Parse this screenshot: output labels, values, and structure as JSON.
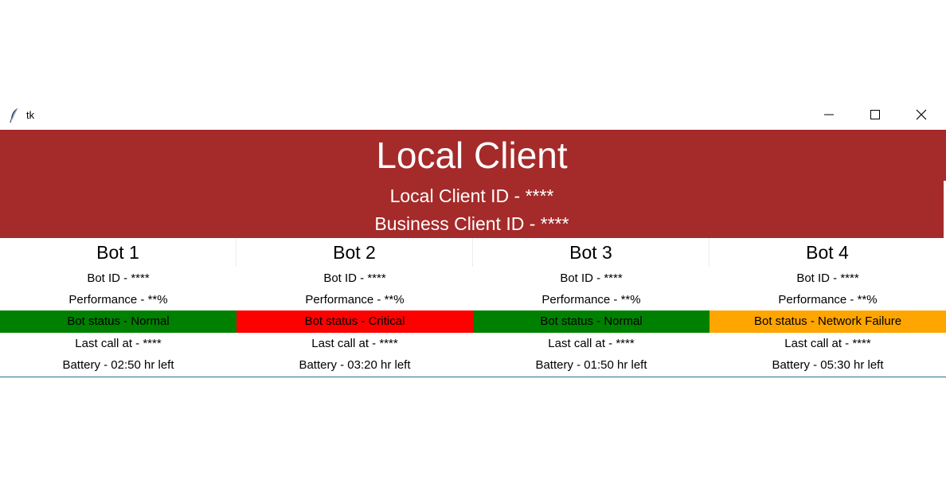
{
  "window": {
    "title": "tk"
  },
  "header": {
    "title": "Local Client",
    "local_client_id": "Local Client ID - ****",
    "business_client_id": "Business Client ID - ****",
    "background": "#a52a2a"
  },
  "bots": [
    {
      "name": "Bot 1",
      "bot_id": "Bot ID - ****",
      "performance": "Performance - **%",
      "status": "Bot status - Normal",
      "status_color": "#008000",
      "last_call": "Last call at - ****",
      "battery": "Battery - 02:50 hr left"
    },
    {
      "name": "Bot 2",
      "bot_id": "Bot ID - ****",
      "performance": "Performance - **%",
      "status": "Bot status - Critical",
      "status_color": "#ff0000",
      "last_call": "Last call at - ****",
      "battery": "Battery - 03:20 hr left"
    },
    {
      "name": "Bot 3",
      "bot_id": "Bot ID - ****",
      "performance": "Performance - **%",
      "status": "Bot status - Normal",
      "status_color": "#008000",
      "last_call": "Last call at - ****",
      "battery": "Battery - 01:50 hr left"
    },
    {
      "name": "Bot 4",
      "bot_id": "Bot ID - ****",
      "performance": "Performance - **%",
      "status": "Bot status - Network Failure",
      "status_color": "#ffa500",
      "last_call": "Last call at - ****",
      "battery": "Battery - 05:30 hr left"
    }
  ]
}
